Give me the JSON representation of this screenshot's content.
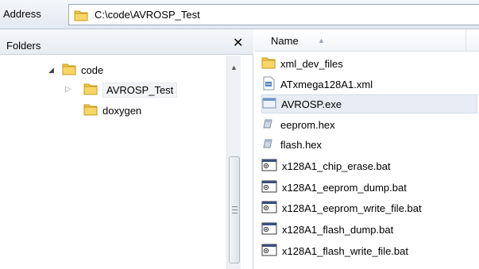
{
  "address": {
    "label": "Address",
    "path": "C:\\code\\AVROSP_Test"
  },
  "folders": {
    "title": "Folders",
    "close_glyph": "✕",
    "tree": [
      {
        "label": "code",
        "icon": "folder-icon",
        "state": "expanded"
      },
      {
        "label": "AVROSP_Test",
        "icon": "folder-icon",
        "state": "collapsed",
        "selected": true
      },
      {
        "label": "doxygen",
        "icon": "folder-icon",
        "state": "none"
      }
    ]
  },
  "files": {
    "column_name": "Name",
    "items": [
      {
        "label": "xml_dev_files",
        "icon": "folder-icon"
      },
      {
        "label": "ATxmega128A1.xml",
        "icon": "xml-file-icon"
      },
      {
        "label": "AVROSP.exe",
        "icon": "exe-file-icon",
        "selected": true
      },
      {
        "label": "eeprom.hex",
        "icon": "hex-file-icon"
      },
      {
        "label": "flash.hex",
        "icon": "hex-file-icon"
      },
      {
        "label": "x128A1_chip_erase.bat",
        "icon": "bat-file-icon"
      },
      {
        "label": "x128A1_eeprom_dump.bat",
        "icon": "bat-file-icon"
      },
      {
        "label": "x128A1_eeprom_write_file.bat",
        "icon": "bat-file-icon"
      },
      {
        "label": "x128A1_flash_dump.bat",
        "icon": "bat-file-icon"
      },
      {
        "label": "x128A1_flash_write_file.bat",
        "icon": "bat-file-icon"
      }
    ]
  },
  "colors": {
    "folder": "#f3c84b",
    "selection": "#e8edf5"
  }
}
